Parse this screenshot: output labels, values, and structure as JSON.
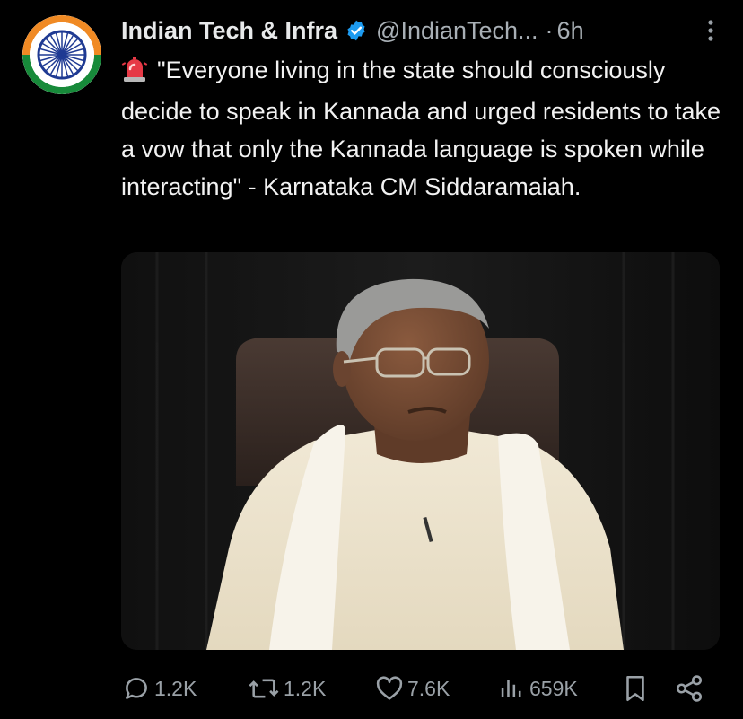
{
  "author": {
    "display_name": "Indian Tech & Infra",
    "handle": "@IndianTech...",
    "separator": "·",
    "time": "6h",
    "avatar_icon": "ashoka-chakra-flag-avatar",
    "verified_icon": "verified-badge-icon"
  },
  "tweet": {
    "emoji_icon": "police-light-siren-icon",
    "text": "\"Everyone living in the state should consciously decide to speak in Kannada and urged residents to take a vow that only the Kannada language is spoken while interacting\" - Karnataka CM Siddaramaiah."
  },
  "actions": {
    "replies": "1.2K",
    "reposts": "1.2K",
    "likes": "7.6K",
    "views": "659K"
  },
  "colors": {
    "background": "#000000",
    "text": "#e7e9ea",
    "muted": "#a8afb5",
    "verified": "#1d9bf0"
  }
}
